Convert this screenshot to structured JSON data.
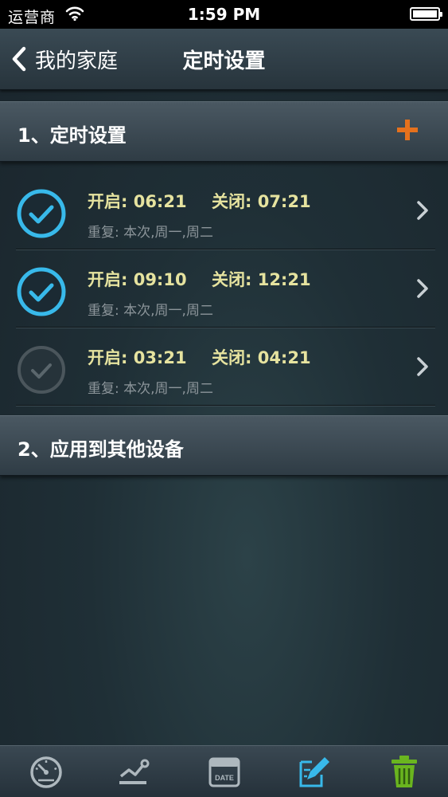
{
  "status_bar": {
    "carrier": "运营商",
    "time": "1:59 PM"
  },
  "nav": {
    "back_label": "我的家庭",
    "title": "定时设置"
  },
  "section1": {
    "title": "1、定时设置"
  },
  "timers": [
    {
      "on_text": "开启: 06:21",
      "off_text": "关闭: 07:21",
      "repeat_text": "重复: 本次,周一,周二",
      "enabled": true
    },
    {
      "on_text": "开启: 09:10",
      "off_text": "关闭: 12:21",
      "repeat_text": "重复: 本次,周一,周二",
      "enabled": true
    },
    {
      "on_text": "开启: 03:21",
      "off_text": "关闭: 04:21",
      "repeat_text": "重复: 本次,周一,周二",
      "enabled": false
    }
  ],
  "section2": {
    "title": "2、应用到其他设备"
  },
  "tab_bar": {
    "items": [
      "gauge-icon",
      "chart-icon",
      "calendar-date-icon",
      "edit-note-icon",
      "trash-icon"
    ],
    "calendar_text": "DATE",
    "active_index": 3
  },
  "colors": {
    "accent_blue": "#38b9ea",
    "add_orange": "#e5711d",
    "time_yellow": "#e6e39f",
    "trash_green": "#6ab51f"
  }
}
